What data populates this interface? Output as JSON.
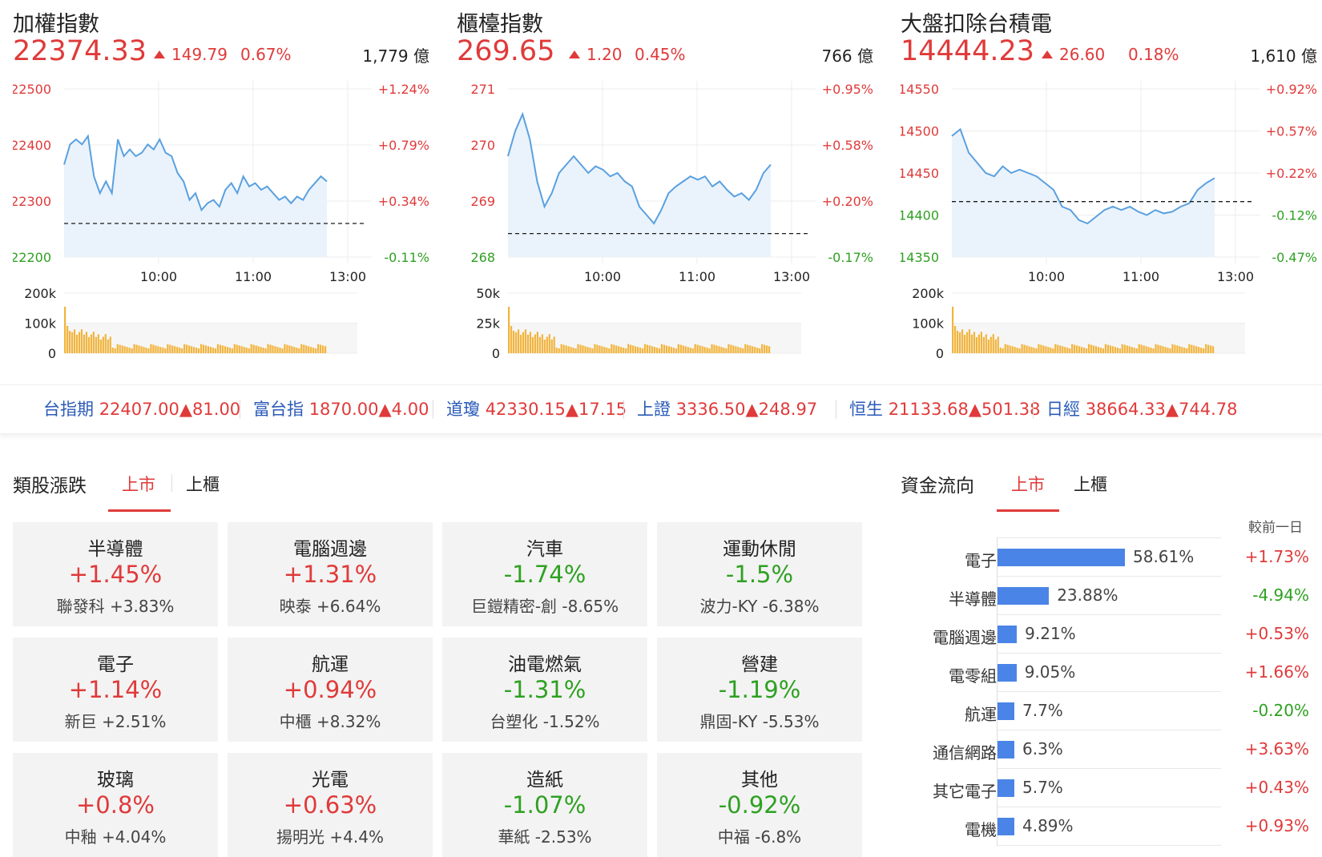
{
  "panels": [
    {
      "title": "加權指數",
      "price": "22374.33",
      "change": "149.79",
      "pct": "0.67%",
      "volume": "1,779 億",
      "y_left": [
        "22500",
        "22400",
        "22300",
        "22200"
      ],
      "y_right": [
        "+1.24%",
        "+0.79%",
        "+0.34%",
        "-0.11%"
      ],
      "x_labels": [
        "10:00",
        "11:00",
        "13:00"
      ],
      "vol_labels": [
        "200k",
        "100k",
        "0"
      ],
      "line": [
        0.45,
        0.33,
        0.3,
        0.33,
        0.28,
        0.52,
        0.62,
        0.55,
        0.62,
        0.3,
        0.4,
        0.36,
        0.4,
        0.38,
        0.33,
        0.36,
        0.3,
        0.38,
        0.4,
        0.5,
        0.55,
        0.66,
        0.62,
        0.72,
        0.68,
        0.66,
        0.7,
        0.6,
        0.56,
        0.62,
        0.52,
        0.58,
        0.56,
        0.6,
        0.58,
        0.62,
        0.66,
        0.64,
        0.68,
        0.64,
        0.66,
        0.6,
        0.56,
        0.52,
        0.55
      ],
      "baseline": 0.8,
      "base_color": "#1b1b1b"
    },
    {
      "title": "櫃檯指數",
      "price": "269.65",
      "change": "1.20",
      "pct": "0.45%",
      "volume": "766 億",
      "y_left": [
        "271",
        "270",
        "269",
        "268"
      ],
      "y_right": [
        "+0.95%",
        "+0.58%",
        "+0.20%",
        "-0.17%"
      ],
      "x_labels": [
        "10:00",
        "11:00",
        "13:00"
      ],
      "vol_labels": [
        "50k",
        "25k",
        "0"
      ],
      "line": [
        0.4,
        0.25,
        0.15,
        0.3,
        0.55,
        0.7,
        0.62,
        0.5,
        0.45,
        0.4,
        0.45,
        0.5,
        0.46,
        0.48,
        0.52,
        0.5,
        0.55,
        0.58,
        0.7,
        0.75,
        0.8,
        0.72,
        0.62,
        0.58,
        0.55,
        0.52,
        0.54,
        0.52,
        0.58,
        0.55,
        0.6,
        0.64,
        0.62,
        0.66,
        0.6,
        0.5,
        0.45
      ],
      "baseline": 0.86,
      "base_color": "#1b1b1b"
    },
    {
      "title": "大盤扣除台積電",
      "price": "14444.23",
      "change": "26.60",
      "pct": "0.18%",
      "volume": "1,610 億",
      "y_left": [
        "14550",
        "14500",
        "14450",
        "14400",
        "14350"
      ],
      "y_right": [
        "+0.92%",
        "+0.57%",
        "+0.22%",
        "-0.12%",
        "-0.47%"
      ],
      "x_labels": [
        "10:00",
        "11:00",
        "13:00"
      ],
      "vol_labels": [
        "200k",
        "100k",
        "0"
      ],
      "line": [
        0.28,
        0.24,
        0.38,
        0.44,
        0.5,
        0.52,
        0.46,
        0.5,
        0.48,
        0.5,
        0.52,
        0.56,
        0.6,
        0.7,
        0.72,
        0.78,
        0.8,
        0.76,
        0.72,
        0.7,
        0.72,
        0.7,
        0.73,
        0.75,
        0.72,
        0.74,
        0.73,
        0.7,
        0.68,
        0.6,
        0.56,
        0.53
      ],
      "baseline": 0.67,
      "base_color": "#1b1b1b"
    }
  ],
  "ticker": [
    {
      "name": "台指期",
      "value": "22407.00",
      "chg": "▲81.00"
    },
    {
      "name": "富台指",
      "value": "1870.00",
      "chg": "▲4.00"
    },
    {
      "name": "道瓊",
      "value": "42330.15",
      "chg": "▲17.15"
    },
    {
      "name": "上證",
      "value": "3336.50",
      "chg": "▲248.97"
    },
    {
      "name": "恒生",
      "value": "21133.68",
      "chg": "▲501.38"
    },
    {
      "name": "日經",
      "value": "38664.33",
      "chg": "▲744.78"
    }
  ],
  "sector": {
    "title": "類股漲跌",
    "tab_listed": "上市",
    "tab_otc": "上櫃",
    "cards": [
      {
        "name": "半導體",
        "pct": "+1.45%",
        "top": "聯發科 +3.83%",
        "dir": "up"
      },
      {
        "name": "電腦週邊",
        "pct": "+1.31%",
        "top": "映泰 +6.64%",
        "dir": "up"
      },
      {
        "name": "汽車",
        "pct": "-1.74%",
        "top": "巨鎧精密-創 -8.65%",
        "dir": "down"
      },
      {
        "name": "運動休閒",
        "pct": "-1.5%",
        "top": "波力-KY -6.38%",
        "dir": "down"
      },
      {
        "name": "電子",
        "pct": "+1.14%",
        "top": "新巨 +2.51%",
        "dir": "up"
      },
      {
        "name": "航運",
        "pct": "+0.94%",
        "top": "中櫃 +8.32%",
        "dir": "up"
      },
      {
        "name": "油電燃氣",
        "pct": "-1.31%",
        "top": "台塑化 -1.52%",
        "dir": "down"
      },
      {
        "name": "營建",
        "pct": "-1.19%",
        "top": "鼎固-KY -5.53%",
        "dir": "down"
      },
      {
        "name": "玻璃",
        "pct": "+0.8%",
        "top": "中釉 +4.04%",
        "dir": "up"
      },
      {
        "name": "光電",
        "pct": "+0.63%",
        "top": "揚明光 +4.4%",
        "dir": "up"
      },
      {
        "name": "造紙",
        "pct": "-1.07%",
        "top": "華紙 -2.53%",
        "dir": "down"
      },
      {
        "name": "其他",
        "pct": "-0.92%",
        "top": "中福 -6.8%",
        "dir": "down"
      }
    ]
  },
  "fund": {
    "title": "資金流向",
    "tab_listed": "上市",
    "tab_otc": "上櫃",
    "header": "較前一日",
    "rows": [
      {
        "name": "電子",
        "share": "58.61%",
        "frac": 0.5861,
        "chg": "+1.73%",
        "dir": "up"
      },
      {
        "name": "半導體",
        "share": "23.88%",
        "frac": 0.2388,
        "chg": "-4.94%",
        "dir": "down"
      },
      {
        "name": "電腦週邊",
        "share": "9.21%",
        "frac": 0.0921,
        "chg": "+0.53%",
        "dir": "up"
      },
      {
        "name": "電零組",
        "share": "9.05%",
        "frac": 0.0905,
        "chg": "+1.66%",
        "dir": "up"
      },
      {
        "name": "航運",
        "share": "7.7%",
        "frac": 0.077,
        "chg": "-0.20%",
        "dir": "down"
      },
      {
        "name": "通信網路",
        "share": "6.3%",
        "frac": 0.063,
        "chg": "+3.63%",
        "dir": "up"
      },
      {
        "name": "其它電子",
        "share": "5.7%",
        "frac": 0.057,
        "chg": "+0.43%",
        "dir": "up"
      },
      {
        "name": "電機",
        "share": "4.89%",
        "frac": 0.0489,
        "chg": "+0.93%",
        "dir": "up"
      }
    ]
  },
  "colors": {
    "up": "#e03a3a",
    "down": "#2ea121",
    "line": "#5aa0e0",
    "area": "#eaf3fb",
    "vol": "#f2b43c",
    "bar": "#4a84e6"
  }
}
